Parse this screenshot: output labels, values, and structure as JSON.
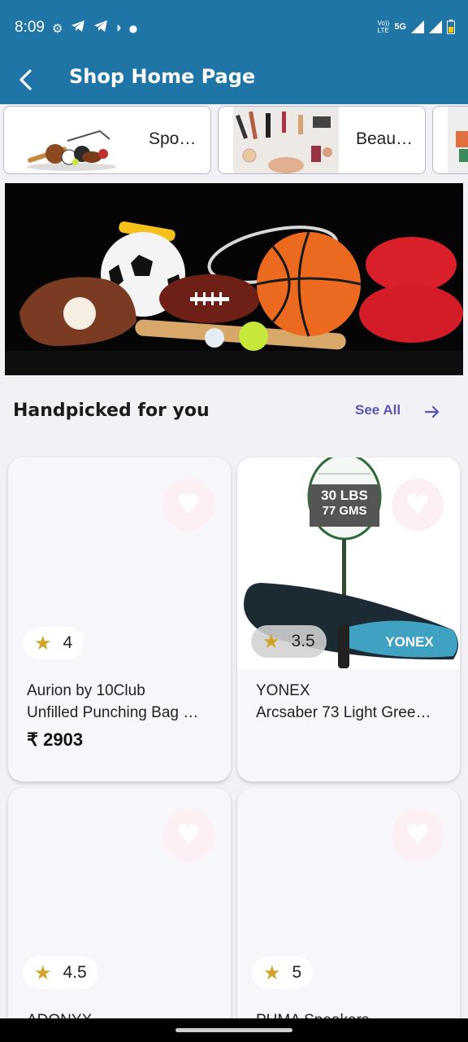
{
  "status_bar": {
    "time": "8:09",
    "network_label_1": "Vo))",
    "network_label_2": "LTE",
    "network_type": "5G",
    "icons": [
      "settings-gear-icon",
      "telegram-icon",
      "telegram-icon",
      "notification-icon",
      "dot-icon",
      "signal-icon",
      "signal-icon",
      "battery-icon"
    ]
  },
  "app_bar": {
    "back_icon": "chevron-left-icon",
    "title": "Shop Home Page"
  },
  "categories": [
    {
      "label": "Spo…",
      "icon": "sports-equipment-image"
    },
    {
      "label": "Beau…",
      "icon": "beauty-products-image"
    },
    {
      "label": "",
      "icon": "gifts-image"
    }
  ],
  "banner": {
    "image": "sports-equipment-banner"
  },
  "section": {
    "title": "Handpicked for you",
    "see_all": "See All",
    "arrow_icon": "arrow-right-icon"
  },
  "products": [
    {
      "rating": "4",
      "brand": "Aurion by 10Club",
      "name": "Unfilled Punching Bag …",
      "price": "₹ 2903"
    },
    {
      "rating": "3.5",
      "brand": "YONEX",
      "name": "Arcsaber 73 Light Gree…",
      "price": "",
      "image_text_1": "30 LBS",
      "image_text_2": "77 GMS",
      "image_logo": "YONEX"
    },
    {
      "rating": "4.5",
      "brand": "ADONYX",
      "name": "",
      "price": ""
    },
    {
      "rating": "5",
      "brand": "PUMA Sneakers",
      "name": "",
      "price": ""
    }
  ],
  "colors": {
    "primary": "#1f75a6",
    "accent": "#5a55b5",
    "star": "#d2a22a",
    "background": "#f2f2f6"
  }
}
